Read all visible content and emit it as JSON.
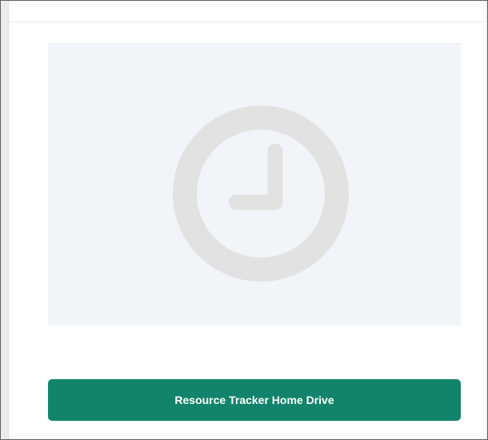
{
  "placeholder": {
    "icon": "clock-icon",
    "background_color": "#f1f4f9",
    "icon_color": "#e2e2e2"
  },
  "action": {
    "button_label": "Resource Tracker Home Drive",
    "button_color": "#12846b"
  }
}
